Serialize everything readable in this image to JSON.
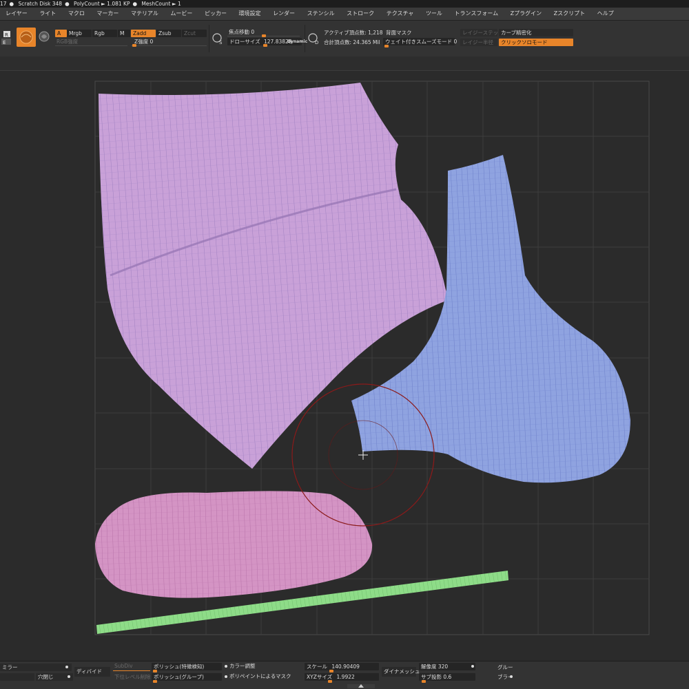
{
  "status": {
    "items": [
      "17",
      "Scratch Disk 348",
      "PolyCount ► 1.081 KP",
      "MeshCount ► 1"
    ]
  },
  "menu": [
    "レイヤー",
    "ライト",
    "マクロ",
    "マーカー",
    "マテリアル",
    "ムービー",
    "ピッカー",
    "環境設定",
    "レンダー",
    "ステンシル",
    "ストローク",
    "テクスチャ",
    "ツール",
    "トランスフォーム",
    "Zプラグイン",
    "Zスクリプト",
    "ヘルプ"
  ],
  "toolbar": {
    "a_label": "A",
    "mrgb": "Mrgb",
    "rgb": "Rgb",
    "m": "M",
    "zadd": "Zadd",
    "zsub": "Zsub",
    "zcut": "Zcut",
    "rgb_intensity": "RGB強度",
    "z_intensity": "Z強度 0",
    "focal_shift": "焦点移動 0",
    "draw_size": "ドローサイズ",
    "draw_size_value": "127.83828",
    "dynamic": "Dynamic",
    "active_points": "アクティブ頂点数: 1,218",
    "total_points": "合計頂点数: 24.365 Mil",
    "backface_mask": "背面マスク",
    "weighted_smooth": "ウェイト付きスムーズモード 0",
    "lazy_step": "レイジーステッ",
    "lazy_radius": "レイジー半径",
    "curve_refine": "カーブ精密化",
    "click_solo": "クリックソロモード"
  },
  "bottom": {
    "mirror": "ミラー",
    "close_holes": "穴閉じ",
    "divide": "ディバイド",
    "subdiv": "SubDiv",
    "del_lower": "下位レベル削除",
    "polish_features": "ポリッシュ(特徴検知)",
    "polish_groups": "ポリッシュ(グループ)",
    "color_adjust": "カラー調整",
    "polypaint_mask": "ポリペイントによるマスク",
    "scale": "スケール",
    "scale_value": "140.90409",
    "xyz_size": "XYZサイズ",
    "xyz_value": "1.9922",
    "dynamesh": "ダイナメッシュ",
    "resolution": "解像度 320",
    "sub_projection": "サブ投影 0.6",
    "group": "グルー",
    "blur": "ブラー"
  },
  "colors": {
    "accent": "#e8852a",
    "patch_purple": "#c9a1d8",
    "patch_blue": "#8fa3e0",
    "patch_pink": "#d494c4",
    "patch_green": "#8edc88",
    "brush_cursor": "#8b1a1a"
  }
}
